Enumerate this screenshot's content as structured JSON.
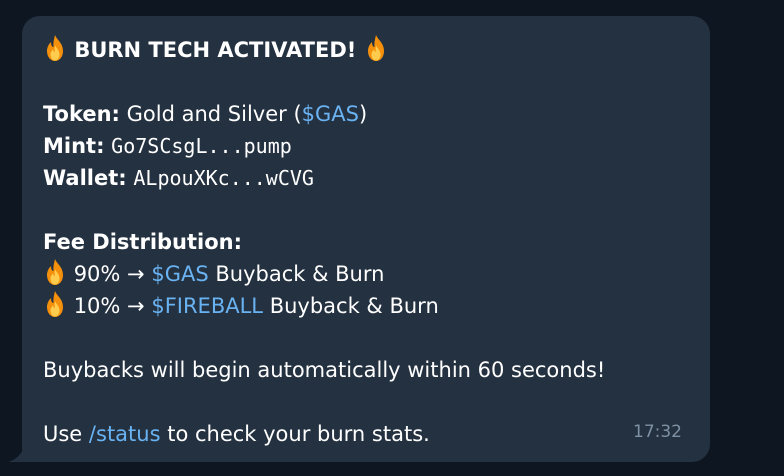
{
  "message": {
    "title": "BURN TECH ACTIVATED!",
    "token_label": "Token:",
    "token_name": "Gold and Silver (",
    "token_ticker": "$GAS",
    "token_close": ")",
    "mint_label": "Mint:",
    "mint_value": "Go7SCsgL...pump",
    "wallet_label": "Wallet:",
    "wallet_value": "ALpouXKc...wCVG",
    "fee_heading": "Fee Distribution:",
    "fee_rows": [
      {
        "percent": "90% →",
        "ticker": "$GAS",
        "action": "Buyback & Burn"
      },
      {
        "percent": "10% →",
        "ticker": "$FIREBALL",
        "action": "Buyback & Burn"
      }
    ],
    "buyback_notice": "Buybacks will begin automatically within 60 seconds!",
    "status_prefix": "Use",
    "status_command": "/status",
    "status_suffix": "to check your burn stats.",
    "time": "17:32",
    "icons": [
      "fire-emoji"
    ]
  },
  "colors": {
    "background": "#0e1621",
    "bubble": "#243140",
    "link": "#6ab3f3",
    "timestamp": "#7f91a4"
  }
}
